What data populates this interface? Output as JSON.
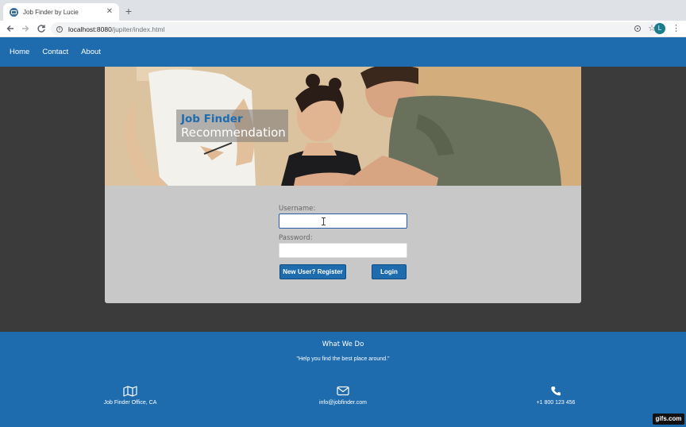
{
  "browser": {
    "tab_title": "Job Finder by Lucie",
    "tab_close": "✕",
    "new_tab": "+",
    "url_host": "localhost:8080",
    "url_path": "/jupiter/index.html",
    "profile_initial": "L"
  },
  "nav": {
    "items": [
      "Home",
      "Contact",
      "About"
    ]
  },
  "hero": {
    "title_line1": "Job Finder",
    "title_line2": "Recommendation"
  },
  "login": {
    "username_label": "Username:",
    "username_value": "",
    "password_label": "Password:",
    "password_value": "",
    "register_button": "New User? Register",
    "login_button": "Login"
  },
  "footer": {
    "heading": "What We Do",
    "tagline": "\"Help you find the best place around.\"",
    "address": "Job Finder Office, CA",
    "email": "info@jobfinder.com",
    "phone": "+1 800 123 456",
    "icons": [
      "map-icon",
      "envelope-icon",
      "phone-icon"
    ]
  },
  "watermark": "gifs.com",
  "colors": {
    "brand_blue": "#1e6cad",
    "panel_grey": "#c8c8c8",
    "page_dark": "#3b3b3b"
  }
}
